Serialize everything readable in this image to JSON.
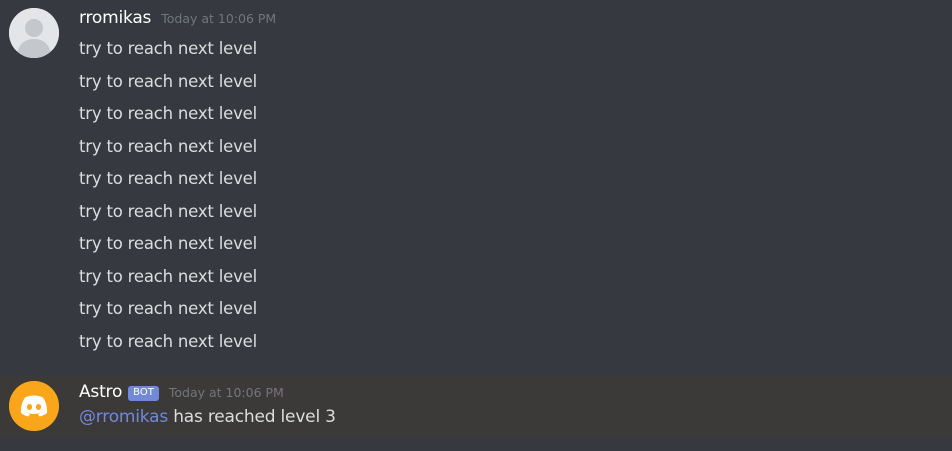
{
  "user_group": {
    "author": "rromikas",
    "timestamp": "Today at 10:06 PM",
    "avatar_icon": "default-user-avatar-icon",
    "lines": [
      "try to reach next level",
      "try to reach next level",
      "try to reach next level",
      "try to reach next level",
      "try to reach next level",
      "try to reach next level",
      "try to reach next level",
      "try to reach next level",
      "try to reach next level",
      "try to reach next level"
    ]
  },
  "bot_message": {
    "author": "Astro",
    "tag": "BOT",
    "timestamp": "Today at 10:06 PM",
    "avatar_icon": "discord-logo-icon",
    "mention": "@rromikas",
    "text": " has reached level 3"
  },
  "colors": {
    "background": "#36393f",
    "highlight": "#3b3a39",
    "mention": "#7289da",
    "bot_avatar": "#faa61a"
  }
}
